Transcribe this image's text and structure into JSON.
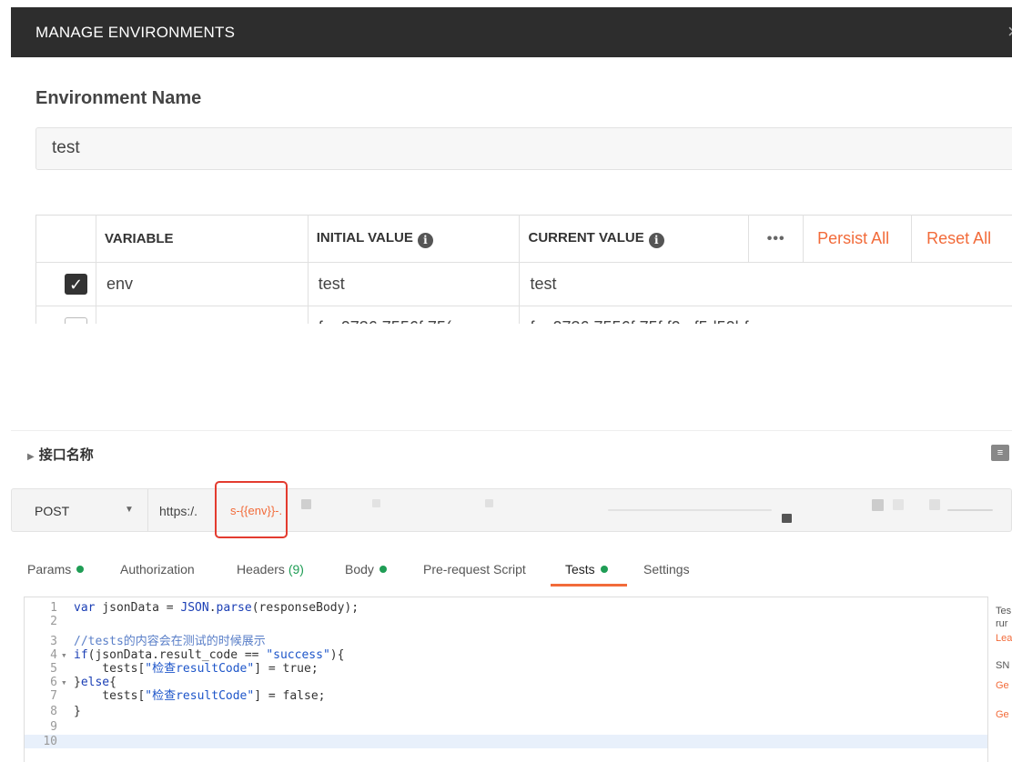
{
  "modal": {
    "title": "MANAGE ENVIRONMENTS",
    "close_icon": "×",
    "env_name_label": "Environment Name",
    "env_name_value": "test",
    "table": {
      "headers": [
        "VARIABLE",
        "INITIAL VALUE",
        "CURRENT VALUE"
      ],
      "more_label": "•••",
      "persist_all": "Persist All",
      "reset_all": "Reset All",
      "rows": [
        {
          "checked": true,
          "variable": "env",
          "initial": "test",
          "current": "test"
        },
        {
          "checked": false,
          "variable": "",
          "initial": "f   ...0736  7556f  75(",
          "current": "f   ...0736  7556f  75f  f0...f5d50bf"
        }
      ]
    }
  },
  "request": {
    "name": "接口名称",
    "method": "POST",
    "url_prefix": "https:/.",
    "url_env": "s-{{env}}-.",
    "tabs": [
      {
        "label": "Params",
        "dot": true
      },
      {
        "label": "Authorization",
        "dot": false
      },
      {
        "label": "Headers",
        "count": "(9)",
        "dot": false
      },
      {
        "label": "Body",
        "dot": true
      },
      {
        "label": "Pre-request Script",
        "dot": false
      },
      {
        "label": "Tests",
        "dot": true,
        "active": true
      },
      {
        "label": "Settings",
        "dot": false
      }
    ],
    "code_lines": [
      "var jsonData = JSON.parse(responseBody);",
      "",
      "//tests的内容会在测试的时候展示",
      "if(jsonData.result_code == \"success\"){",
      "    tests[\"检查resultCode\"] = true;",
      "}else{",
      "    tests[\"检查resultCode\"] = false;",
      "}",
      "",
      ""
    ],
    "side_panel": [
      "Tes",
      "rur",
      "Lea",
      "SN",
      "Ge",
      "Ge"
    ]
  },
  "colors": {
    "accent": "#f26b3a",
    "header_bg": "#2d2d2d",
    "status_green": "#1f9d55",
    "highlight_red": "#e33b2f"
  }
}
